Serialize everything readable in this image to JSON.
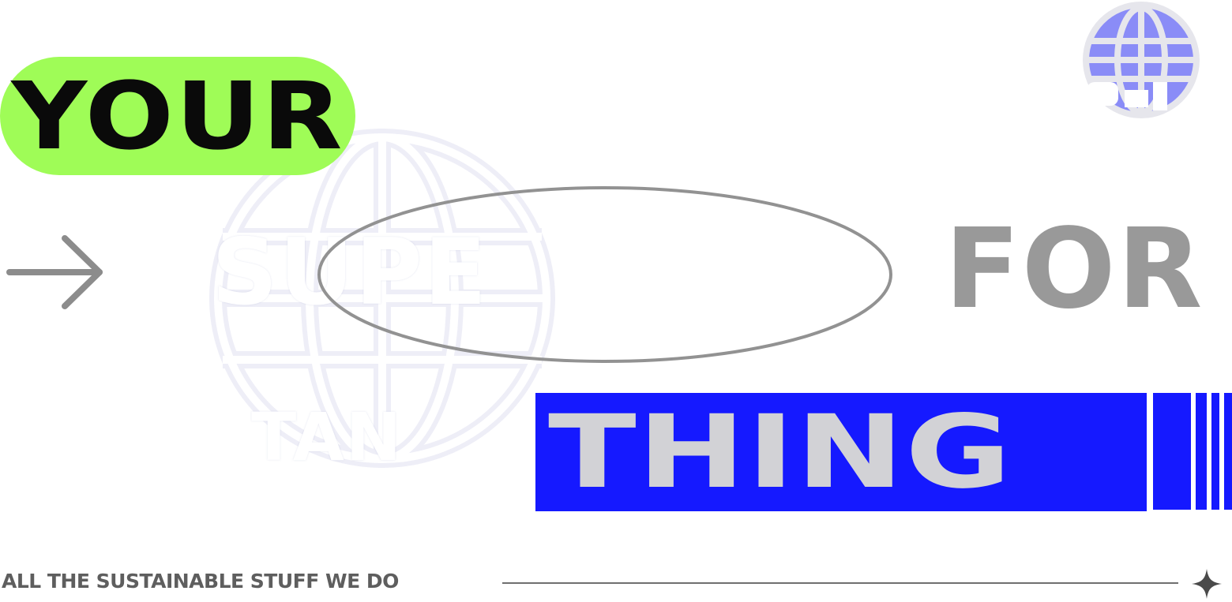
{
  "headline": {
    "word_1": "YOUR",
    "word_2": "FOR",
    "word_3": "THING",
    "ghost_top": "SUPE",
    "ghost_bottom": "TAN"
  },
  "footer": {
    "tagline": "ALL THE SUSTAINABLE STUFF WE DO"
  },
  "icons": {
    "arrow": "arrow-right-icon",
    "globe": "globe-icon",
    "sparkle": "sparkle-icon"
  },
  "colors": {
    "pill_green": "#9ffc57",
    "bar_blue": "#1519ff",
    "thing_text": "#d2d2d6",
    "for_gray": "#999999",
    "globe_violet": "#8a8cf7",
    "tagline_gray": "#5e5e5e"
  }
}
